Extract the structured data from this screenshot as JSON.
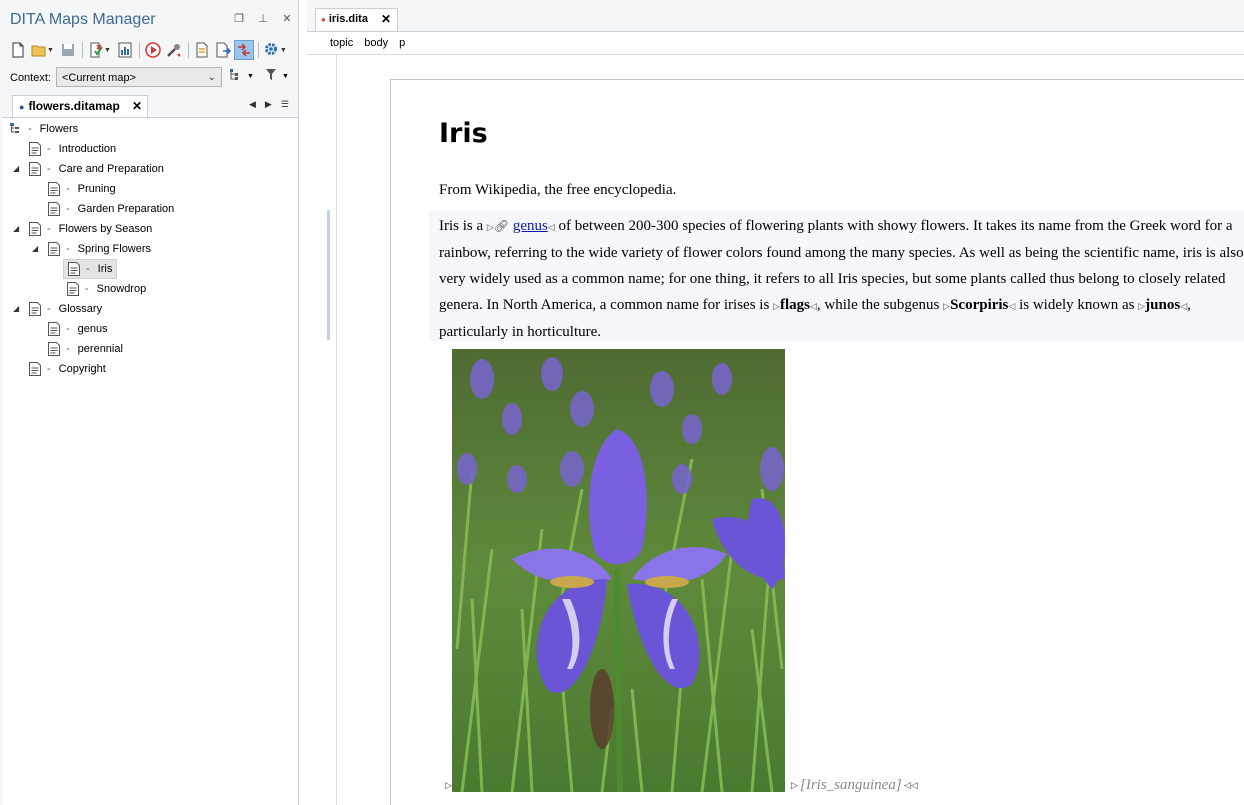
{
  "panel": {
    "title": "DITA Maps Manager",
    "context_label": "Context:",
    "context_value": "<Current map>",
    "map_tab": "flowers.ditamap"
  },
  "tree": [
    {
      "label": "Flowers",
      "level": 0,
      "expander": "",
      "icon": "map-root-icon"
    },
    {
      "label": "Introduction",
      "level": 1,
      "expander": "",
      "icon": "topic-icon"
    },
    {
      "label": "Care and Preparation",
      "level": 1,
      "expander": "◢",
      "icon": "topic-icon"
    },
    {
      "label": "Pruning",
      "level": 2,
      "expander": "",
      "icon": "topic-icon"
    },
    {
      "label": "Garden Preparation",
      "level": 2,
      "expander": "",
      "icon": "topic-icon"
    },
    {
      "label": "Flowers by Season",
      "level": 1,
      "expander": "◢",
      "icon": "topic-icon"
    },
    {
      "label": "Spring Flowers",
      "level": 2,
      "expander": "◢",
      "icon": "topic-icon"
    },
    {
      "label": "Iris",
      "level": 3,
      "expander": "",
      "icon": "topic-icon",
      "selected": true
    },
    {
      "label": "Snowdrop",
      "level": 3,
      "expander": "",
      "icon": "topic-icon"
    },
    {
      "label": "Glossary",
      "level": 1,
      "expander": "◢",
      "icon": "topic-icon"
    },
    {
      "label": "genus",
      "level": 2,
      "expander": "",
      "icon": "topic-icon"
    },
    {
      "label": "perennial",
      "level": 2,
      "expander": "",
      "icon": "topic-icon"
    },
    {
      "label": "Copyright",
      "level": 1,
      "expander": "",
      "icon": "topic-icon"
    }
  ],
  "editor": {
    "tab": "iris.dita",
    "breadcrumbs": [
      "topic",
      "body",
      "p"
    ],
    "title": "Iris",
    "shortdesc": "From Wikipedia, the free encyclopedia.",
    "p1": "Iris is a ",
    "link": "genus",
    "p2": " of between 200-300 species of flowering plants with showy flowers. It takes its name from the Greek word for a rainbow, referring to the wide variety of flower colors found among the many species. As well as being the scientific name, iris is also very widely used as a common name; for one thing, it refers to all Iris species, but some plants called thus belong to closely related genera. In North America, a common name for irises is ",
    "flags": "flags",
    "p3": ", while the subgenus ",
    "scorpiris": "Scorpiris",
    "p4": " is widely known as ",
    "junos": "junos",
    "p5": ", particularly in horticulture.",
    "image_alt": "[Iris_sanguinea]"
  },
  "colors": {
    "panel_title": "#3d6b99",
    "link": "#0a1aa6",
    "modified_dot": "#e0453a"
  }
}
